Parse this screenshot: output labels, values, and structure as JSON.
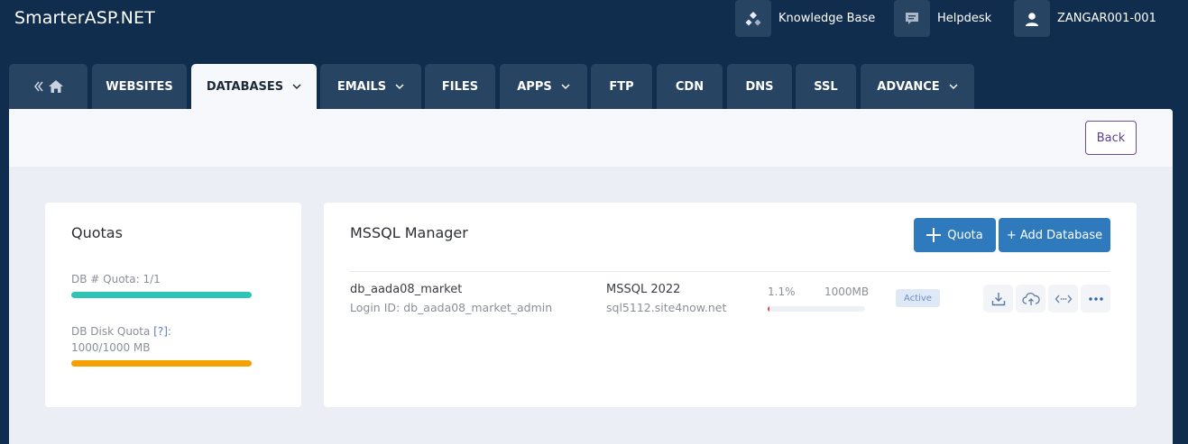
{
  "header": {
    "brand": "SmarterASP.NET",
    "links": [
      {
        "label": "Knowledge Base",
        "icon": "knowledge-base-icon"
      },
      {
        "label": "Helpdesk",
        "icon": "chat-icon"
      },
      {
        "label": "ZANGAR001-001",
        "icon": "user-icon"
      }
    ]
  },
  "tabs": [
    {
      "label": "",
      "icon": "home-icon"
    },
    {
      "label": "WEBSITES"
    },
    {
      "label": "DATABASES",
      "active": true
    },
    {
      "label": "EMAILS"
    },
    {
      "label": "FILES"
    },
    {
      "label": "APPS"
    },
    {
      "label": "FTP"
    },
    {
      "label": "CDN"
    },
    {
      "label": "DNS"
    },
    {
      "label": "SSL"
    },
    {
      "label": "ADVANCE"
    }
  ],
  "actionbar": {
    "back_label": "Back"
  },
  "quotas": {
    "title": "Quotas",
    "db_quota_label": "DB # Quota: 1/1",
    "disk_quota_label": "DB Disk Quota",
    "disk_quota_help": "[?]",
    "disk_quota_suffix": ":",
    "disk_quota_value": "1000/1000 MB",
    "db_quota_fraction": 1.0,
    "disk_quota_fraction": 1.0
  },
  "manager": {
    "title": "MSSQL Manager",
    "quota_button": "Quota",
    "add_button": "+ Add Database",
    "row": {
      "name": "db_aada08_market",
      "login": "Login ID: db_aada08_market_admin",
      "version": "MSSQL 2022",
      "server": "sql5112.site4now.net",
      "usage_percent": "1.1%",
      "usage_total": "1000MB",
      "usage_fraction": 0.011,
      "status": "Active"
    }
  },
  "colors": {
    "header_bg": "#102d4d",
    "tab_bg": "#284463",
    "teal_bar": "#2ec4b6",
    "orange_bar": "#f4a100",
    "primary_button": "#2f79bd",
    "usage_fill": "#e64545"
  }
}
